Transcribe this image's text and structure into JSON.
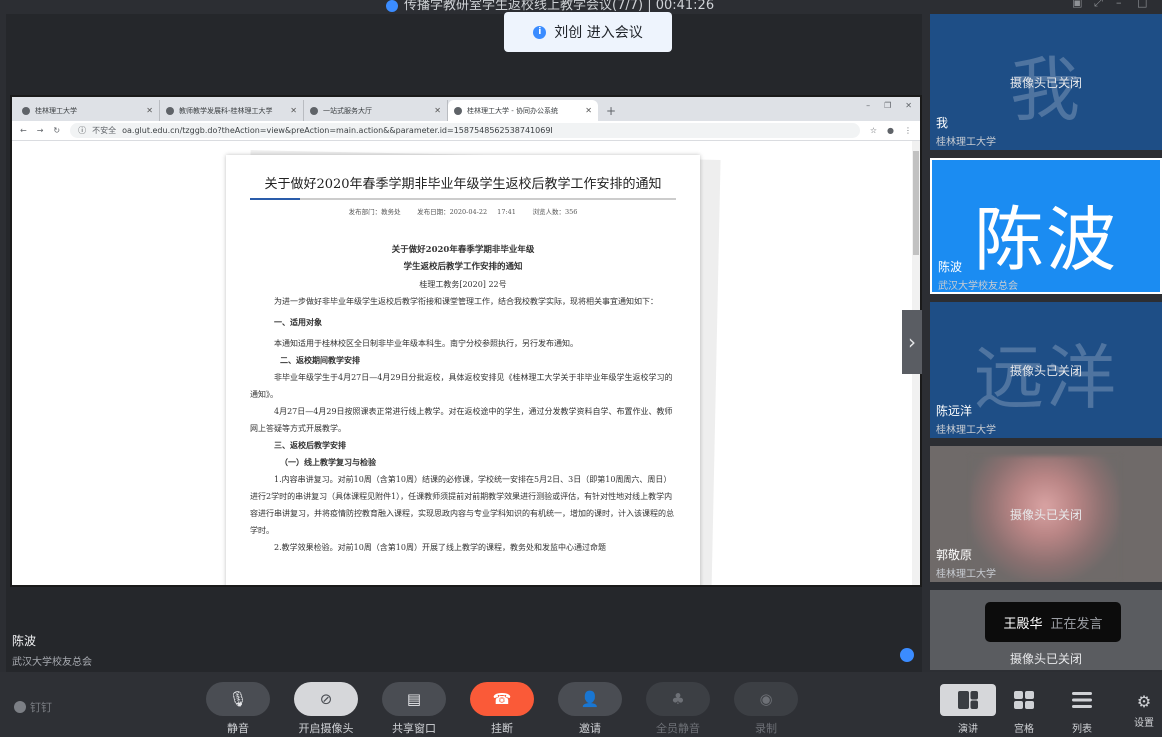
{
  "window": {
    "title": "传播学教研室学生返校线上教学会议(7/7) | 00:41:26"
  },
  "toast": {
    "text": "刘创 进入会议"
  },
  "browser": {
    "tabs": [
      {
        "label": "桂林理工大学"
      },
      {
        "label": "教师教学发展科-桂林理工大学"
      },
      {
        "label": "一站式服务大厅"
      },
      {
        "label": "桂林理工大学 - 协同办公系统"
      }
    ],
    "address": {
      "insecure_label": "不安全",
      "url": "oa.glut.edu.cn/tzggb.do?theAction=view&preAction=main.action&&parameter.id=1587548562538741069I"
    }
  },
  "document": {
    "title": "关于做好2020年春季学期非毕业年级学生返校后教学工作安排的通知",
    "meta": "发布部门：教务处　 发布日期：2020-04-22 17:41　 浏览人数：356",
    "heading1": "关于做好2020年春季学期非毕业年级",
    "heading2": "学生返校后教学工作安排的通知",
    "doc_no": "桂理工教务[2020] 22号",
    "p_intro": "为进一步做好非毕业年级学生返校后教学衔接和课堂管理工作，结合我校教学实际，现将相关事宜通知如下：",
    "s1": "一、适用对象",
    "p1": "本通知适用于桂林校区全日制非毕业年级本科生。南宁分校参照执行，另行发布通知。",
    "s2": "二、返校期间教学安排",
    "p2a": "非毕业年级学生于4月27日—4月29日分批返校，具体返校安排见《桂林理工大学关于非毕业年级学生返校学习的通知》。",
    "p2b": "4月27日—4月29日按照课表正常进行线上教学。对在返校途中的学生，通过分发教学资料自学、布置作业、教师网上答疑等方式开展教学。",
    "s3": "三、返校后教学安排",
    "s3a": "（一）线上教学复习与检验",
    "p3a": "1.内容串讲复习。对前10周（含第10周）结课的必修课，学校统一安排在5月2日、3日（即第10周周六、周日）进行2学时的串讲复习（具体课程见附件1），任课教师须提前对前期教学效果进行测验或评估，有针对性地对线上教学内容进行串讲复习，并将疫情防控教育融入课程，实现思政内容与专业学科知识的有机统一，增加的课时，计入该课程的总学时。",
    "p3b": "2.教学效果检验。对前10周（含第10周）开展了线上教学的课程，教务处和发监中心通过命题"
  },
  "stage": {
    "name": "陈波",
    "org": "武汉大学校友总会"
  },
  "participants": [
    {
      "big": "我",
      "camera": "摄像头已关闭",
      "name": "我",
      "org": "桂林理工大学"
    },
    {
      "big": "陈波",
      "camera": "",
      "name": "陈波",
      "org": "武汉大学校友总会"
    },
    {
      "big": "远洋",
      "camera": "摄像头已关闭",
      "name": "陈远洋",
      "org": "桂林理工大学"
    },
    {
      "big": "",
      "camera": "摄像头已关闭",
      "name": "郭敬原",
      "org": "桂林理工大学"
    },
    {
      "big": "",
      "camera": "摄像头已关闭",
      "name": "",
      "org": ""
    }
  ],
  "speaking": {
    "who": "王殿华",
    "status": "正在发言"
  },
  "toolbar": {
    "brand": "钉钉",
    "mute": "静音",
    "camera": "开启摄像头",
    "share": "共享窗口",
    "hangup": "挂断",
    "invite": "邀请",
    "mute_all": "全员静音",
    "record": "录制",
    "view_speaker": "演讲",
    "view_grid": "宫格",
    "view_list": "列表",
    "settings": "设置"
  }
}
